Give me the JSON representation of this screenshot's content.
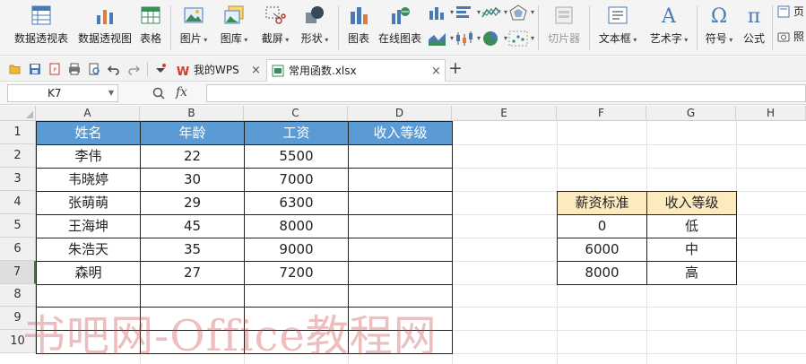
{
  "ribbon": {
    "pivot_table": "数据透视表",
    "pivot_chart": "数据透视图",
    "table": "表格",
    "picture": "图片",
    "gallery": "图库",
    "screenshot": "截屏",
    "shape": "形状",
    "chart": "图表",
    "online_chart": "在线图表",
    "slicer": "切片器",
    "textbox": "文本框",
    "wordart": "艺术字",
    "symbol": "符号",
    "formula": "公式",
    "header_partial": "页",
    "photo_partial": "照"
  },
  "tabs": [
    {
      "label": "我的WPS"
    },
    {
      "label": "常用函数.xlsx"
    }
  ],
  "formula_bar": {
    "cell_ref": "K7",
    "fx": "fx",
    "value": ""
  },
  "columns": [
    "A",
    "B",
    "C",
    "D",
    "E",
    "F",
    "G",
    "H"
  ],
  "rows": [
    "1",
    "2",
    "3",
    "4",
    "5",
    "6",
    "7",
    "8",
    "9",
    "10"
  ],
  "table": {
    "headers": [
      "姓名",
      "年龄",
      "工资",
      "收入等级"
    ],
    "rows": [
      [
        "李伟",
        "22",
        "5500",
        ""
      ],
      [
        "韦晓婷",
        "30",
        "7000",
        ""
      ],
      [
        "张萌萌",
        "29",
        "6300",
        ""
      ],
      [
        "王海坤",
        "45",
        "8000",
        ""
      ],
      [
        "朱浩天",
        "35",
        "9000",
        ""
      ],
      [
        "森明",
        "27",
        "7200",
        ""
      ]
    ]
  },
  "ref_table": {
    "headers": [
      "薪资标准",
      "收入等级"
    ],
    "rows": [
      [
        "0",
        "低"
      ],
      [
        "6000",
        "中"
      ],
      [
        "8000",
        "高"
      ]
    ]
  },
  "watermark": "书吧网-Office教程网",
  "colors": {
    "header_blue": "#5b9bd5",
    "ref_header_yellow": "#fdeabf",
    "wps_red": "#d43b2a"
  }
}
